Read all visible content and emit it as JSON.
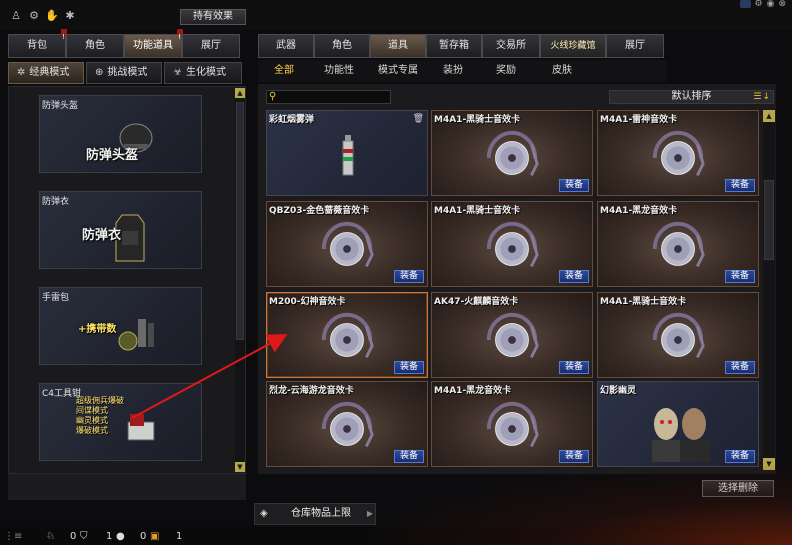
{
  "top": {
    "icons": [
      "character-icon",
      "settings-icon",
      "gloves-icon",
      "bug-icon"
    ],
    "hold_effect_button": "持有效果"
  },
  "left_tabs": [
    {
      "label": "背包",
      "badge": true,
      "active": false
    },
    {
      "label": "角色",
      "badge": false,
      "active": false
    },
    {
      "label": "功能道具",
      "badge": true,
      "active": true
    },
    {
      "label": "展厅",
      "badge": false,
      "active": false
    }
  ],
  "modes": [
    {
      "label": "经典模式",
      "icon": "star-icon",
      "active": true
    },
    {
      "label": "挑战模式",
      "icon": "target-icon",
      "active": false
    },
    {
      "label": "生化模式",
      "icon": "biohazard-icon",
      "active": false
    }
  ],
  "left_slots": [
    {
      "label": "防弹头盔",
      "item_text": "防弹头盔"
    },
    {
      "label": "防弹衣",
      "item_text": "防弹衣"
    },
    {
      "label": "手雷包",
      "item_text": "+携带数"
    },
    {
      "label": "C4工具钳",
      "item_lines": [
        "超级佣兵爆破",
        "间谍模式",
        "幽灵模式",
        "爆破模式"
      ]
    }
  ],
  "right_tabs": [
    {
      "label": "武器",
      "active": false
    },
    {
      "label": "角色",
      "active": false
    },
    {
      "label": "道具",
      "active": true
    },
    {
      "label": "暂存箱",
      "active": false
    },
    {
      "label": "交易所",
      "active": false
    },
    {
      "label": "火线珍藏馆",
      "active": false,
      "special": true
    },
    {
      "label": "展厅",
      "active": false
    }
  ],
  "sub_tabs": [
    {
      "label": "全部",
      "active": true
    },
    {
      "label": "功能性",
      "active": false
    },
    {
      "label": "模式专属",
      "active": false
    },
    {
      "label": "装扮",
      "active": false
    },
    {
      "label": "奖励",
      "active": false
    },
    {
      "label": "皮肤",
      "active": false
    }
  ],
  "search": {
    "placeholder": ""
  },
  "sort": {
    "label": "默认排序"
  },
  "equip_label": "装备",
  "items": [
    {
      "title": "彩虹烟雾弹",
      "kind": "smoke",
      "equip": false
    },
    {
      "title": "M4A1-黑骑士音效卡",
      "kind": "disc",
      "equip": true
    },
    {
      "title": "M4A1-雷神音效卡",
      "kind": "disc",
      "equip": true
    },
    {
      "title": "QBZ03-金色蔷薇音效卡",
      "kind": "disc",
      "equip": true
    },
    {
      "title": "M4A1-黑骑士音效卡",
      "kind": "disc",
      "equip": true
    },
    {
      "title": "M4A1-黑龙音效卡",
      "kind": "disc",
      "equip": true
    },
    {
      "title": "M200-幻神音效卡",
      "kind": "disc",
      "equip": true
    },
    {
      "title": "AK47-火麒麟音效卡",
      "kind": "disc",
      "equip": true
    },
    {
      "title": "M4A1-黑骑士音效卡",
      "kind": "disc",
      "equip": true
    },
    {
      "title": "烈龙-云海游龙音效卡",
      "kind": "disc",
      "equip": true
    },
    {
      "title": "M4A1-黑龙音效卡",
      "kind": "disc",
      "equip": true
    },
    {
      "title": "幻影幽灵",
      "kind": "ghost",
      "equip": true
    }
  ],
  "select_delete": "选择删除",
  "storage_limit": "仓库物品上限",
  "status": {
    "a": "0",
    "b": "1",
    "c": "0",
    "d": "1"
  }
}
